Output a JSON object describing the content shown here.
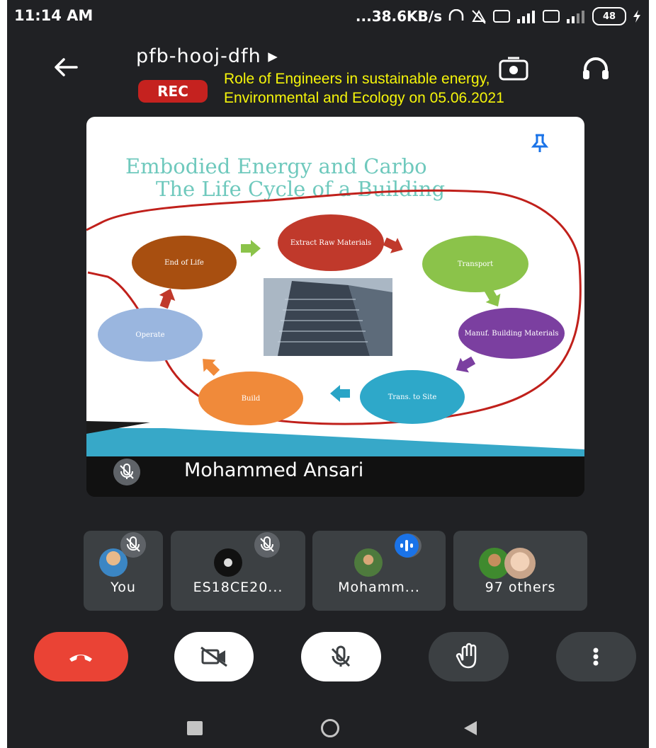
{
  "status_bar": {
    "time": "11:14 AM",
    "network_speed": "...38.6KB/s",
    "battery_level": "48"
  },
  "header": {
    "meeting_code": "pfb-hooj-dfh ▸",
    "rec_badge": "REC",
    "caption_line1": "Role of Engineers in sustainable energy,",
    "caption_line2": "Environmental and Ecology on 05.06.2021"
  },
  "slide": {
    "title_line1": "Embodied Energy and Carbo",
    "title_line2": "The Life Cycle of a Building",
    "stages": {
      "extract": "Extract Raw Materials",
      "transport": "Transport",
      "manufacture": "Manuf. Building Materials",
      "transport_to_site": "Trans. to Site",
      "build": "Build",
      "operate": "Operate",
      "end_of_life": "End of Life"
    }
  },
  "presenter": {
    "name": "Mohammed Ansari"
  },
  "participants": [
    {
      "label": "You"
    },
    {
      "label": "ES18CE20..."
    },
    {
      "label": "Mohamm..."
    },
    {
      "label": "97 others"
    }
  ],
  "colors": {
    "end_call": "#ea4335",
    "rec": "#c5221f",
    "caption": "#f5f50a",
    "speaking_indicator": "#1a73e8"
  }
}
